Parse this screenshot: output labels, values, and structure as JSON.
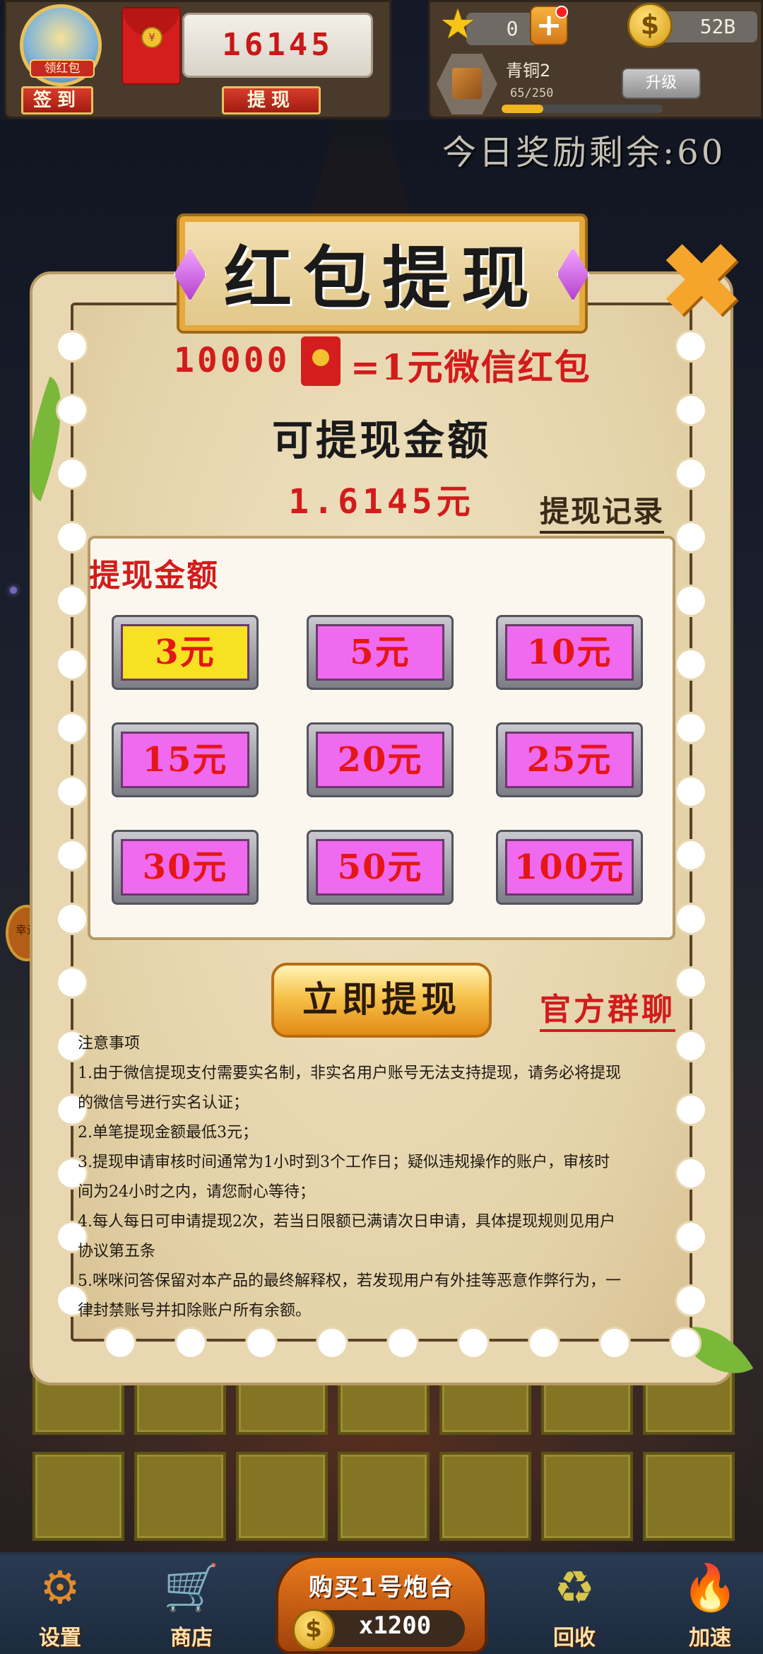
{
  "hud": {
    "avatar_badge": "领红包",
    "redpack_balance": "16145",
    "signin_label": "签到",
    "withdraw_label": "提现",
    "stars": "0",
    "plus_symbol": "+",
    "coins": "52B",
    "coin_symbol": "$",
    "rank_name": "青铜2",
    "rank_progress_text": "65/250",
    "rank_progress": 0.26,
    "upgrade_label": "升级",
    "today_reward": "今日奖励剩余:60"
  },
  "dialog": {
    "title": "红包提现",
    "close_symbol": "✖",
    "rate_left": "10000",
    "rate_right": "=1元微信红包",
    "available_label": "可提现金额",
    "available_amount": "1.6145元",
    "records_link": "提现记录",
    "options_title": "提现金额",
    "amounts": [
      "3元",
      "5元",
      "10元",
      "15元",
      "20元",
      "25元",
      "30元",
      "50元",
      "100元"
    ],
    "selected_amount_index": 0,
    "withdraw_button": "立即提现",
    "group_chat_link": "官方群聊",
    "notice": [
      "注意事项",
      "1.由于微信提现支付需要实名制，非实名用户账号无法支持提现，请务必将提现",
      "的微信号进行实名认证；",
      "2.单笔提现金额最低3元；",
      "3.提现申请审核时间通常为1小时到3个工作日；疑似违规操作的账户，审核时",
      "间为24小时之内，请您耐心等待；",
      "4.每人每日可申请提现2次，若当日限额已满请次日申请，具体提现规则见用户",
      "协议第五条",
      "5.咪咪问答保留对本产品的最终解释权，若发现用户有外挂等恶意作弊行为，一",
      "律封禁账号并扣除账户所有余额。"
    ]
  },
  "side_badge": "幸运",
  "bottom_nav": {
    "settings": "设置",
    "shop": "商店",
    "buy_label": "购买1号炮台",
    "buy_price": "x1200",
    "recycle": "回收",
    "speedup": "加速"
  },
  "colors": {
    "accent_red": "#d21c1c",
    "selected_option": "#f6e222",
    "option_fill": "#f06af0"
  }
}
